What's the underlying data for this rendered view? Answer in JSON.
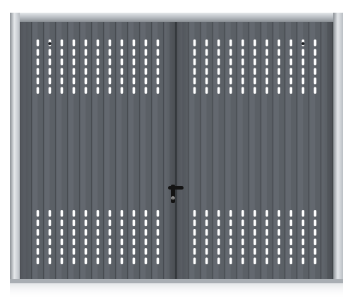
{
  "scene": {
    "subject": "garage-door",
    "door": {
      "panel_color": "#5b6066",
      "panel_light": "#6a7077",
      "panel_dark": "#474b50",
      "frame_color": "#b9bec3",
      "frame_light": "#e4e7ea",
      "frame_dark": "#8b9095",
      "slot_color": "#ffffff",
      "background": "#ffffff",
      "ribs_per_leaf": 13,
      "slot_rows": 6,
      "handle_color": "#141414"
    }
  }
}
